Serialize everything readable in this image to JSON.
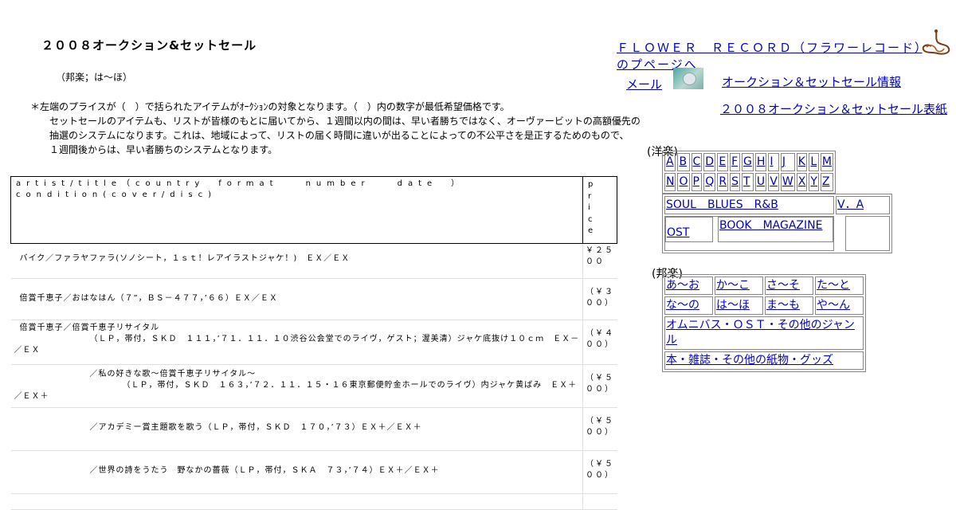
{
  "page_title": "２００８オークション&セットセール",
  "subtitle": "（邦楽；は～ほ）",
  "notes": {
    "line1": "＊左端のプライスが（　）で括られたアイテムがｵｰｸｼｮﾝの対象となります。（　）内の数字が最低希望価格です。",
    "line2": "セットセールのアイテムも、リストが皆様のもとに届いてから、１週間以内の間は、早い者勝ちではなく、オーヴァービットの高額優先の",
    "line3": "抽選のシステムになります。これは、地域によって、リストの届く時間に違いが出ることによっての不公平さを是正するためのもので、",
    "line4": "１週間後からは、早い者勝ちのシステムとなります。"
  },
  "table": {
    "header": "artist/title（country　format　　number　　date　）condition(cover/disc)",
    "header_price": "price",
    "rows": [
      {
        "line1": "バイク／ファラヤファラ(ソノシート，１ｓｔ！レアイラストジャケ！)　ＥＸ／ＥＸ",
        "line2": "",
        "price": "￥２５００"
      },
      {
        "line1": "倍賞千恵子／おはなはん（７”，ＢＳ－４７７，’６６）ＥＸ／ＥＸ",
        "line2": "",
        "price": "（￥３００）"
      },
      {
        "line1": "倍賞千恵子／倍賞千恵子リサイタル",
        "line2": "（ＬＰ，帯付，ＳＫＤ　１１１，’７１．１１．１０渋谷公会堂でのライヴ，ゲスト；渥美清）ジャケ底抜け１０ｃｍ　ＥＸ－／ＥＸ",
        "price": "（￥４００）"
      },
      {
        "line1": "／私の好きな歌～倍賞千恵子リサイタル～",
        "line2": "（ＬＰ，帯付，ＳＫＤ　１６３，’７２．１１．１５・１６東京郵便貯金ホールでのライヴ）内ジャケ黄ばみ　ＥＸ＋／ＥＸ＋",
        "price": "（￥５００）"
      },
      {
        "line1": "／アカデミー賞主題歌を歌う（ＬＰ，帯付，ＳＫＤ　１７０，’７３）ＥＸ＋／ＥＸ＋",
        "line2": "",
        "price": "（￥５００）"
      },
      {
        "line1": "／世界の詩をうたう　野なかの薔薇（ＬＰ，帯付，ＳＫＡ　７３，’７４）ＥＸ＋／ＥＸ＋",
        "line2": "",
        "price": "（￥５００）"
      }
    ]
  },
  "right": {
    "flower_link": "ＦＬＯＷＥＲ　ＲＥＣＯＲＤ（フラワーレコード）のプページへ",
    "mail": "メール",
    "auction_info": "オークション＆セットセール情報",
    "auction_2008": "２００８オークション＆セットセール表紙",
    "western_label": "(洋楽)",
    "japanese_label": "(邦楽)",
    "letters_row1": [
      "A",
      "B",
      "C",
      "D",
      "E",
      "F",
      "G",
      "H",
      "I",
      "J",
      "K",
      "L",
      "M"
    ],
    "letters_row2": [
      "N",
      "O",
      "P",
      "Q",
      "R",
      "S",
      "T",
      "U",
      "V",
      "W",
      "X",
      "Y",
      "Z"
    ],
    "soul": "SOUL　BLUES　R&B",
    "va": "V．A",
    "ost": "OST",
    "book": "BOOK　MAGAZINE",
    "kana_row1": [
      "あ～お",
      "か～こ",
      "さ～そ",
      "た～と"
    ],
    "kana_row2": [
      "な～の",
      "は～ほ",
      "ま～も",
      "や～ん"
    ],
    "omnibus": "オムニバス・ＯＳＴ・その他のジャンル",
    "books_jp": "本・雑誌・その他の紙物・グッズ"
  }
}
